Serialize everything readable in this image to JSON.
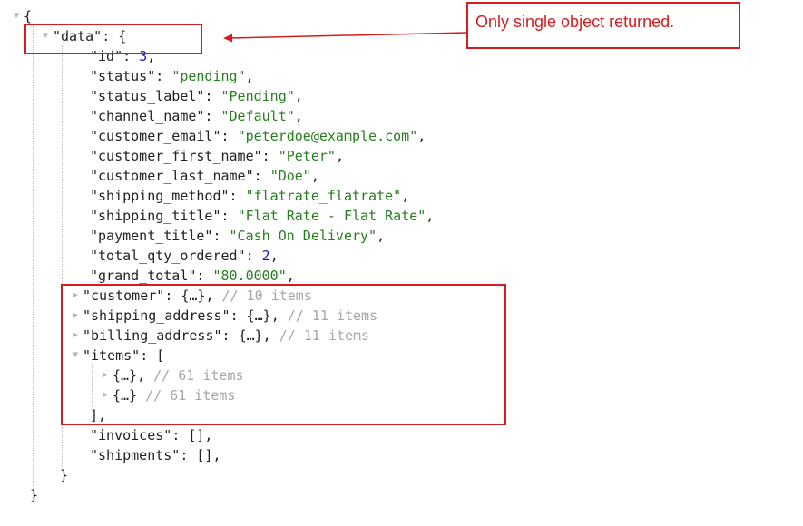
{
  "json": {
    "open_brace": "{",
    "close_brace": "}",
    "data": {
      "key": "\"data\"",
      "open": "{",
      "close": "}",
      "fields": [
        {
          "key": "\"id\"",
          "value": "3",
          "type": "num"
        },
        {
          "key": "\"status\"",
          "value": "\"pending\"",
          "type": "str"
        },
        {
          "key": "\"status_label\"",
          "value": "\"Pending\"",
          "type": "str"
        },
        {
          "key": "\"channel_name\"",
          "value": "\"Default\"",
          "type": "str"
        },
        {
          "key": "\"customer_email\"",
          "value": "\"peterdoe@example.com\"",
          "type": "str"
        },
        {
          "key": "\"customer_first_name\"",
          "value": "\"Peter\"",
          "type": "str"
        },
        {
          "key": "\"customer_last_name\"",
          "value": "\"Doe\"",
          "type": "str"
        },
        {
          "key": "\"shipping_method\"",
          "value": "\"flatrate_flatrate\"",
          "type": "str"
        },
        {
          "key": "\"shipping_title\"",
          "value": "\"Flat Rate - Flat Rate\"",
          "type": "str"
        },
        {
          "key": "\"payment_title\"",
          "value": "\"Cash On Delivery\"",
          "type": "str"
        },
        {
          "key": "\"total_qty_ordered\"",
          "value": "2",
          "type": "num"
        },
        {
          "key": "\"grand_total\"",
          "value": "\"80.0000\"",
          "type": "str"
        }
      ],
      "collapsed": [
        {
          "key": "\"customer\"",
          "comment": "// 10 items"
        },
        {
          "key": "\"shipping_address\"",
          "comment": "// 11 items"
        },
        {
          "key": "\"billing_address\"",
          "comment": "// 11 items"
        }
      ],
      "items": {
        "key": "\"items\"",
        "open": "[",
        "close": "],",
        "entries": [
          {
            "comment": "// 61 items"
          },
          {
            "comment": "// 61 items"
          }
        ]
      },
      "invoices": {
        "key": "\"invoices\"",
        "value": "[],"
      },
      "shipments": {
        "key": "\"shipments\"",
        "value": "[],"
      }
    }
  },
  "annotation": {
    "note": "Only single object returned.",
    "color": "#d61c1c"
  },
  "colors": {
    "string": "#267f1e",
    "number": "#1a1aa6",
    "comment": "#a6a6a6"
  },
  "icons": {
    "expanded": "triangle-down",
    "collapsed": "triangle-right"
  }
}
